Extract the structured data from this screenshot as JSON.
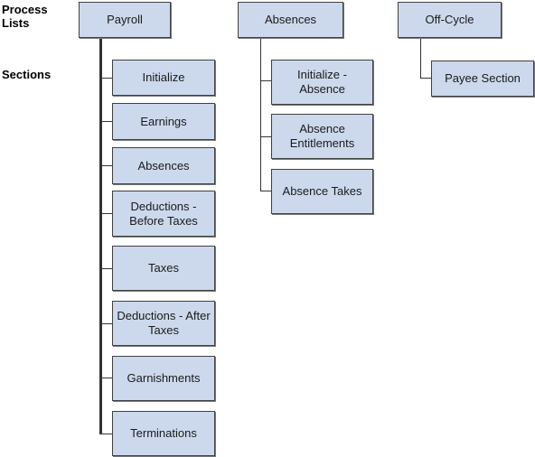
{
  "row_labels": {
    "process_lists": "Process\nLists",
    "sections": "Sections"
  },
  "colors": {
    "box_fill": "#ccd9ec",
    "box_border": "#404040",
    "connector": "#333333"
  },
  "process_lists": [
    {
      "name": "Payroll",
      "sections": [
        "Initialize",
        "Earnings",
        "Absences",
        "Deductions - Before Taxes",
        "Taxes",
        "Deductions - After Taxes",
        "Garnishments",
        "Terminations"
      ]
    },
    {
      "name": "Absences",
      "sections": [
        "Initialize - Absence",
        "Absence Entitlements",
        "Absence Takes"
      ]
    },
    {
      "name": "Off-Cycle",
      "sections": [
        "Payee Section"
      ]
    }
  ]
}
